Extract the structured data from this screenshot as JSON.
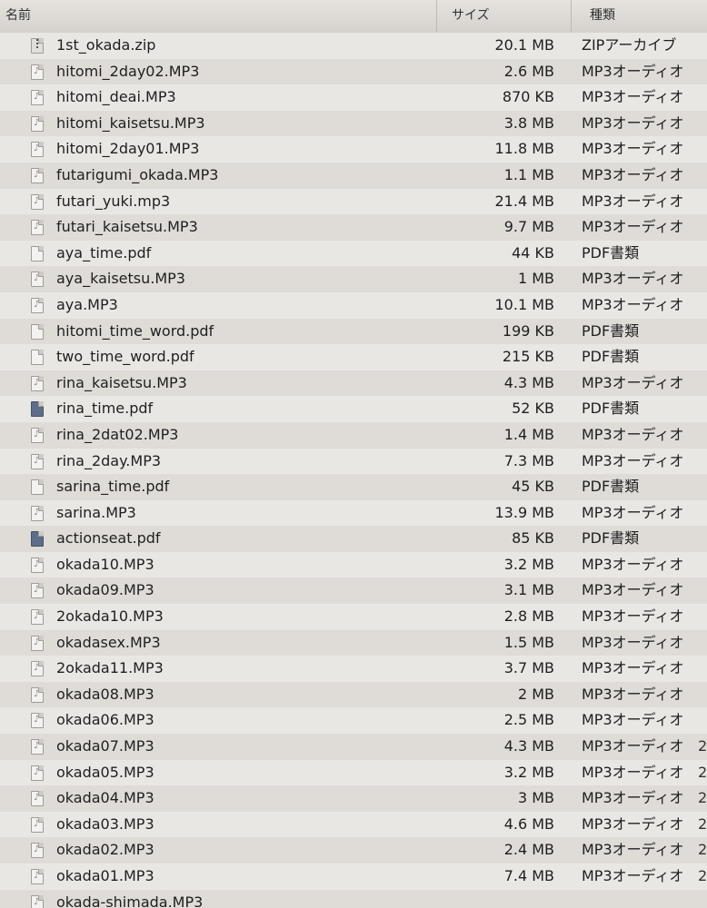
{
  "header": {
    "name": "名前",
    "size": "サイズ",
    "kind": "種類"
  },
  "rows": [
    {
      "name": "1st_okada.zip",
      "size": "20.1 MB",
      "kind": "ZIPアーカイブ",
      "icon": "zip-archive-icon"
    },
    {
      "name": "hitomi_2day02.MP3",
      "size": "2.6 MB",
      "kind": "MP3オーディオ",
      "icon": "audio-file-icon"
    },
    {
      "name": "hitomi_deai.MP3",
      "size": "870 KB",
      "kind": "MP3オーディオ",
      "icon": "audio-file-icon"
    },
    {
      "name": "hitomi_kaisetsu.MP3",
      "size": "3.8 MB",
      "kind": "MP3オーディオ",
      "icon": "audio-file-icon"
    },
    {
      "name": "hitomi_2day01.MP3",
      "size": "11.8 MB",
      "kind": "MP3オーディオ",
      "icon": "audio-file-icon"
    },
    {
      "name": "futarigumi_okada.MP3",
      "size": "1.1 MB",
      "kind": "MP3オーディオ",
      "icon": "audio-file-icon"
    },
    {
      "name": "futari_yuki.mp3",
      "size": "21.4 MB",
      "kind": "MP3オーディオ",
      "icon": "audio-file-icon"
    },
    {
      "name": "futari_kaisetsu.MP3",
      "size": "9.7 MB",
      "kind": "MP3オーディオ",
      "icon": "audio-file-icon"
    },
    {
      "name": "aya_time.pdf",
      "size": "44 KB",
      "kind": "PDF書類",
      "icon": "pdf-file-icon"
    },
    {
      "name": "aya_kaisetsu.MP3",
      "size": "1 MB",
      "kind": "MP3オーディオ",
      "icon": "audio-file-icon"
    },
    {
      "name": "aya.MP3",
      "size": "10.1 MB",
      "kind": "MP3オーディオ",
      "icon": "audio-file-icon"
    },
    {
      "name": "hitomi_time_word.pdf",
      "size": "199 KB",
      "kind": "PDF書類",
      "icon": "pdf-file-icon"
    },
    {
      "name": "two_time_word.pdf",
      "size": "215 KB",
      "kind": "PDF書類",
      "icon": "pdf-file-icon"
    },
    {
      "name": "rina_kaisetsu.MP3",
      "size": "4.3 MB",
      "kind": "MP3オーディオ",
      "icon": "audio-file-icon"
    },
    {
      "name": "rina_time.pdf",
      "size": "52 KB",
      "kind": "PDF書類",
      "icon": "pdf-preview-icon"
    },
    {
      "name": "rina_2dat02.MP3",
      "size": "1.4 MB",
      "kind": "MP3オーディオ",
      "icon": "audio-file-icon"
    },
    {
      "name": "rina_2day.MP3",
      "size": "7.3 MB",
      "kind": "MP3オーディオ",
      "icon": "audio-file-icon"
    },
    {
      "name": "sarina_time.pdf",
      "size": "45 KB",
      "kind": "PDF書類",
      "icon": "pdf-file-icon"
    },
    {
      "name": "sarina.MP3",
      "size": "13.9 MB",
      "kind": "MP3オーディオ",
      "icon": "audio-file-icon"
    },
    {
      "name": "actionseat.pdf",
      "size": "85 KB",
      "kind": "PDF書類",
      "icon": "pdf-preview-icon"
    },
    {
      "name": "okada10.MP3",
      "size": "3.2 MB",
      "kind": "MP3オーディオ",
      "icon": "audio-file-icon"
    },
    {
      "name": "okada09.MP3",
      "size": "3.1 MB",
      "kind": "MP3オーディオ",
      "icon": "audio-file-icon"
    },
    {
      "name": "2okada10.MP3",
      "size": "2.8 MB",
      "kind": "MP3オーディオ",
      "icon": "audio-file-icon"
    },
    {
      "name": "okadasex.MP3",
      "size": "1.5 MB",
      "kind": "MP3オーディオ",
      "icon": "audio-file-icon"
    },
    {
      "name": "2okada11.MP3",
      "size": "3.7 MB",
      "kind": "MP3オーディオ",
      "icon": "audio-file-icon"
    },
    {
      "name": "okada08.MP3",
      "size": "2 MB",
      "kind": "MP3オーディオ",
      "icon": "audio-file-icon"
    },
    {
      "name": "okada06.MP3",
      "size": "2.5 MB",
      "kind": "MP3オーディオ",
      "icon": "audio-file-icon"
    },
    {
      "name": "okada07.MP3",
      "size": "4.3 MB",
      "kind": "MP3オーディオ",
      "icon": "audio-file-icon",
      "extra": "2"
    },
    {
      "name": "okada05.MP3",
      "size": "3.2 MB",
      "kind": "MP3オーディオ",
      "icon": "audio-file-icon",
      "extra": "2"
    },
    {
      "name": "okada04.MP3",
      "size": "3 MB",
      "kind": "MP3オーディオ",
      "icon": "audio-file-icon",
      "extra": "2"
    },
    {
      "name": "okada03.MP3",
      "size": "4.6 MB",
      "kind": "MP3オーディオ",
      "icon": "audio-file-icon",
      "extra": "2"
    },
    {
      "name": "okada02.MP3",
      "size": "2.4 MB",
      "kind": "MP3オーディオ",
      "icon": "audio-file-icon",
      "extra": "2"
    },
    {
      "name": "okada01.MP3",
      "size": "7.4 MB",
      "kind": "MP3オーディオ",
      "icon": "audio-file-icon",
      "extra": "2"
    },
    {
      "name": "okada-shimada.MP3",
      "size": "",
      "kind": "",
      "icon": "audio-file-icon"
    }
  ]
}
